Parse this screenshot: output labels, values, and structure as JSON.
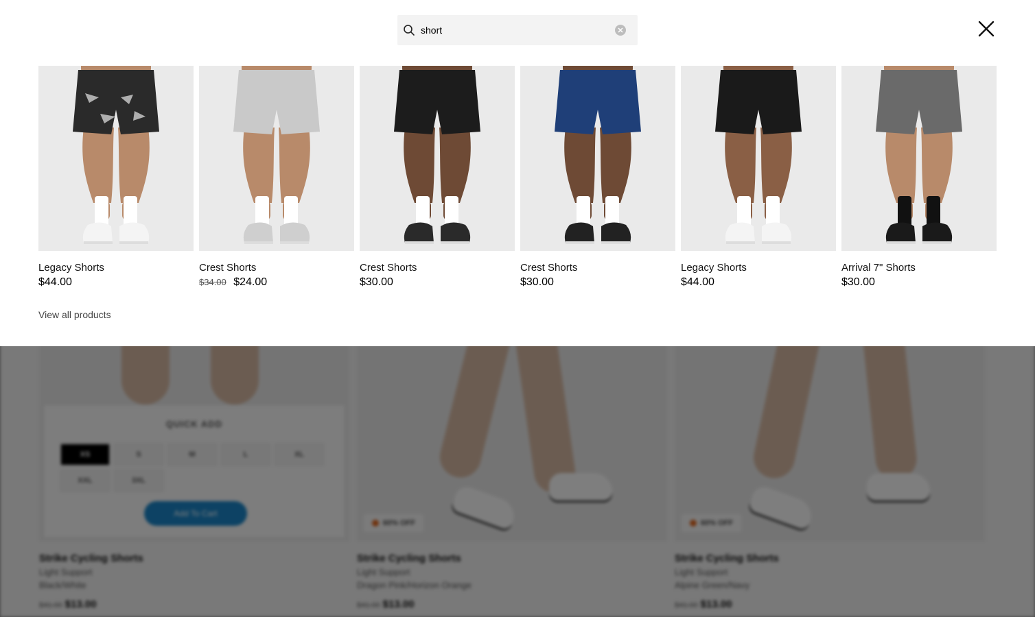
{
  "search": {
    "query": "short"
  },
  "products": [
    {
      "name": "Legacy Shorts",
      "old_price": "",
      "price": "$44.00",
      "short_color": "#2a2a2a",
      "short_pattern": "camo",
      "sock_color": "#ffffff",
      "shoe_color": "#f4f4f4",
      "skin": "#b88a6a"
    },
    {
      "name": "Crest Shorts",
      "old_price": "$34.00",
      "price": "$24.00",
      "short_color": "#c9c9c9",
      "short_pattern": "plain",
      "sock_color": "#ffffff",
      "shoe_color": "#cfcfcf",
      "skin": "#b88a6a"
    },
    {
      "name": "Crest Shorts",
      "old_price": "",
      "price": "$30.00",
      "short_color": "#1c1c1c",
      "short_pattern": "plain",
      "sock_color": "#ffffff",
      "shoe_color": "#2a2a2a",
      "skin": "#6e4a35"
    },
    {
      "name": "Crest Shorts",
      "old_price": "",
      "price": "$30.00",
      "short_color": "#1f3f78",
      "short_pattern": "plain",
      "sock_color": "#ffffff",
      "shoe_color": "#222222",
      "skin": "#6e4a35"
    },
    {
      "name": "Legacy Shorts",
      "old_price": "",
      "price": "$44.00",
      "short_color": "#1a1a1a",
      "short_pattern": "plain",
      "sock_color": "#ffffff",
      "shoe_color": "#f4f4f4",
      "skin": "#8a5f45"
    },
    {
      "name": "Arrival 7\" Shorts",
      "old_price": "",
      "price": "$30.00",
      "short_color": "#6a6a6a",
      "short_pattern": "plain",
      "sock_color": "#111111",
      "shoe_color": "#1a1a1a",
      "skin": "#b88a6a"
    }
  ],
  "view_all_label": "View all products",
  "background": {
    "quick_add": {
      "title": "QUICK ADD",
      "sizes": [
        "XS",
        "S",
        "M",
        "L",
        "XL",
        "XXL",
        "3XL"
      ],
      "selected_size": "XS",
      "add_to_cart_label": "Add To Cart"
    },
    "badge_label": "60% OFF",
    "cards": [
      {
        "name": "Strike Cycling Shorts",
        "support": "Light Support",
        "color": "Black/White",
        "old_price": "$41.00",
        "price": "$13.00"
      },
      {
        "name": "Strike Cycling Shorts",
        "support": "Light Support",
        "color": "Dragon Pink/Horizon Orange",
        "old_price": "$41.00",
        "price": "$13.00"
      },
      {
        "name": "Strike Cycling Shorts",
        "support": "Light Support",
        "color": "Alpine Green/Navy",
        "old_price": "$41.00",
        "price": "$13.00"
      }
    ]
  },
  "colors": {
    "accent_blue": "#1a85c8",
    "badge_orange": "#e0651d"
  }
}
